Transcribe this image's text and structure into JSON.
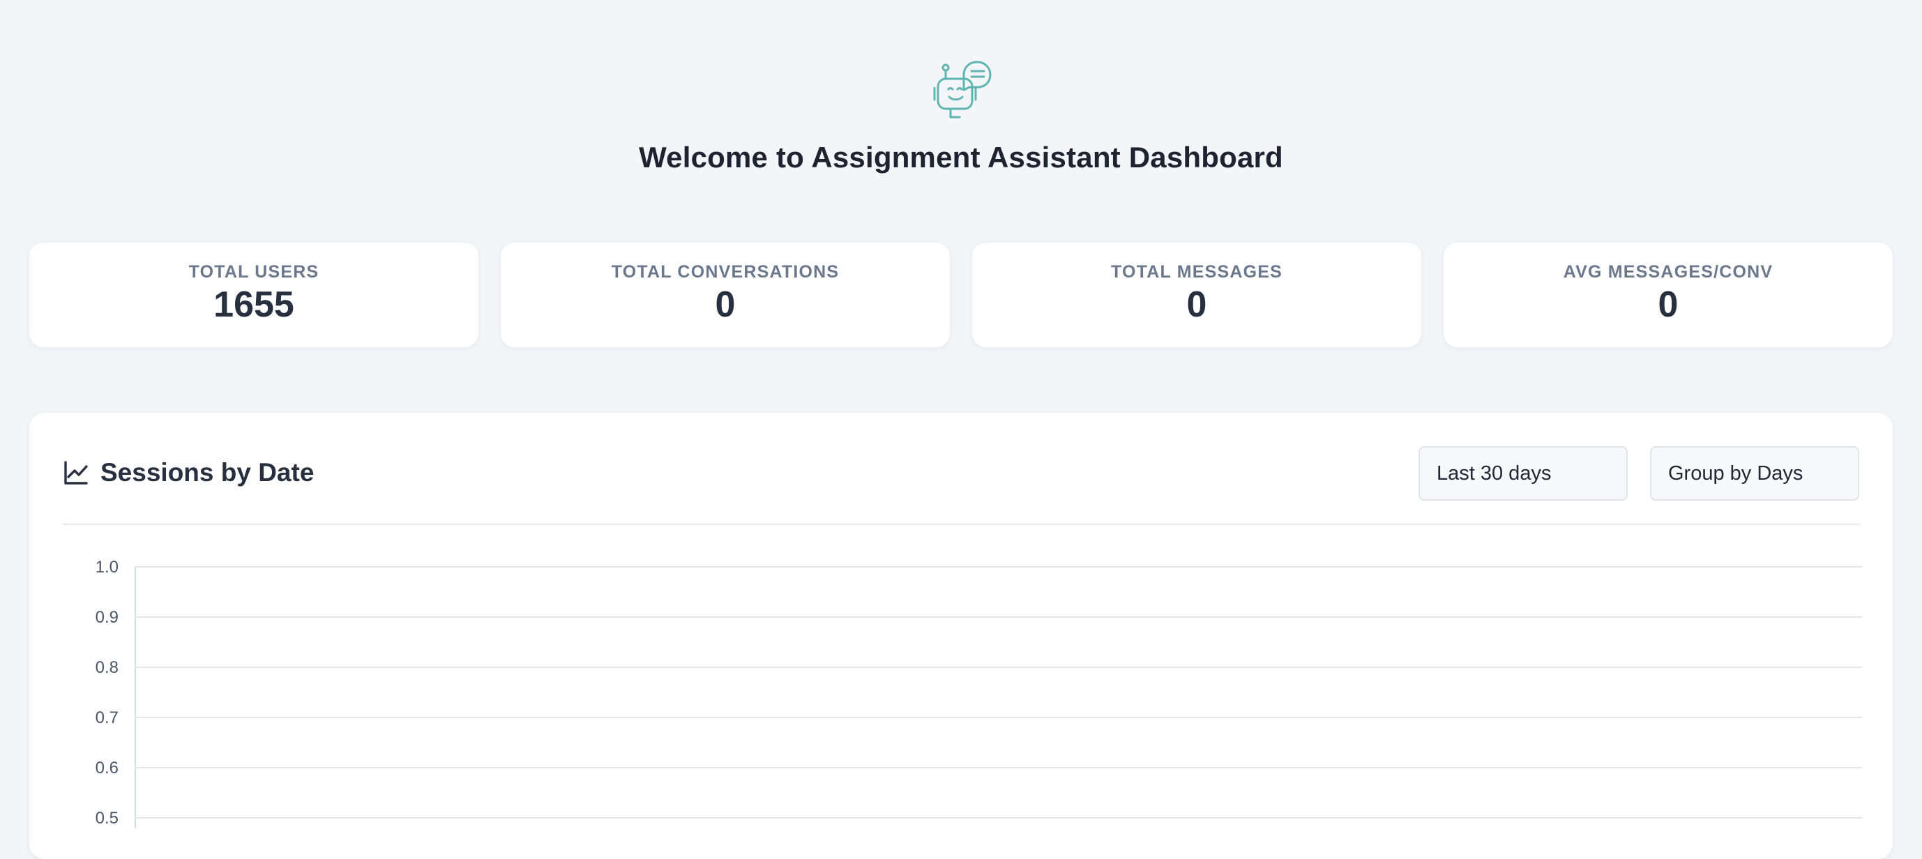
{
  "header": {
    "logo_icon": "chatbot-icon",
    "title": "Welcome to Assignment Assistant Dashboard"
  },
  "stats": [
    {
      "label": "TOTAL USERS",
      "value": "1655"
    },
    {
      "label": "TOTAL CONVERSATIONS",
      "value": "0"
    },
    {
      "label": "TOTAL MESSAGES",
      "value": "0"
    },
    {
      "label": "AVG MESSAGES/CONV",
      "value": "0"
    }
  ],
  "sessions_panel": {
    "icon": "line-chart-icon",
    "title": "Sessions by Date",
    "range_select": {
      "value": "Last 30 days"
    },
    "group_select": {
      "value": "Group by Days"
    }
  },
  "colors": {
    "background": "#f4f5f8",
    "card": "#ffffff",
    "title_text": "#1d2430",
    "muted_text": "#6b778a",
    "accent": "#5fb5b2",
    "gridline": "#e3e6eb"
  },
  "chart_data": {
    "type": "line",
    "title": "",
    "xlabel": "",
    "ylabel": "",
    "x": [],
    "series": [],
    "y_ticks": [
      1.0,
      0.9,
      0.8,
      0.7,
      0.6,
      0.5
    ],
    "y_tick_labels": [
      "1.0",
      "0.9",
      "0.8",
      "0.7",
      "0.6",
      "0.5"
    ],
    "ylim": [
      0.5,
      1.0
    ],
    "grid": true
  }
}
